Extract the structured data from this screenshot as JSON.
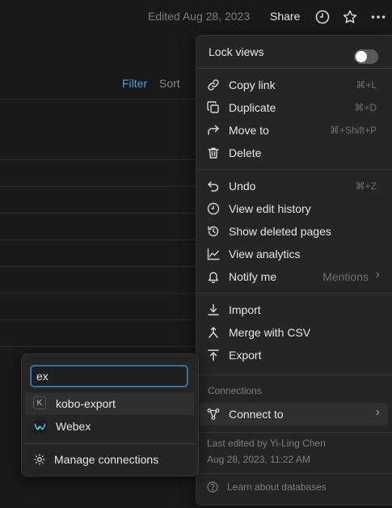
{
  "topbar": {
    "edited": "Edited Aug 28, 2023",
    "share": "Share",
    "icons": [
      "clock-icon",
      "star-icon",
      "more-icon"
    ]
  },
  "database": {
    "filter": "Filter",
    "sort": "Sort"
  },
  "menu": {
    "lock_views": {
      "label": "Lock views",
      "enabled": false
    },
    "group1": [
      {
        "label": "Copy link",
        "shortcut": "⌘+L",
        "icon": "link-icon"
      },
      {
        "label": "Duplicate",
        "shortcut": "⌘+D",
        "icon": "duplicate-icon"
      },
      {
        "label": "Move to",
        "shortcut": "⌘+Shift+P",
        "icon": "move-arrow-icon"
      },
      {
        "label": "Delete",
        "shortcut": "",
        "icon": "trash-icon"
      }
    ],
    "group2": [
      {
        "label": "Undo",
        "shortcut": "⌘+Z",
        "icon": "undo-icon"
      },
      {
        "label": "View edit history",
        "shortcut": "",
        "icon": "history-icon"
      },
      {
        "label": "Show deleted pages",
        "shortcut": "",
        "icon": "restore-icon"
      },
      {
        "label": "View analytics",
        "shortcut": "",
        "icon": "analytics-icon"
      },
      {
        "label": "Notify me",
        "value": "Mentions",
        "icon": "bell-icon"
      }
    ],
    "group3": [
      {
        "label": "Import",
        "icon": "import-icon"
      },
      {
        "label": "Merge with CSV",
        "icon": "merge-icon"
      },
      {
        "label": "Export",
        "icon": "export-icon"
      }
    ],
    "connections_title": "Connections",
    "connect_to": "Connect to",
    "last_edited_by": "Last edited by Yi-Ling Chen",
    "last_edited_at": "Aug 28, 2023, 11:22 AM",
    "learn": "Learn about databases"
  },
  "submenu": {
    "search_value": "ex",
    "items": [
      {
        "label": "kobo-export",
        "badge": "K"
      },
      {
        "label": "Webex"
      }
    ],
    "manage": "Manage connections"
  },
  "colors": {
    "accent": "#4a9ee6",
    "background": "#191919",
    "menu": "#252525"
  }
}
